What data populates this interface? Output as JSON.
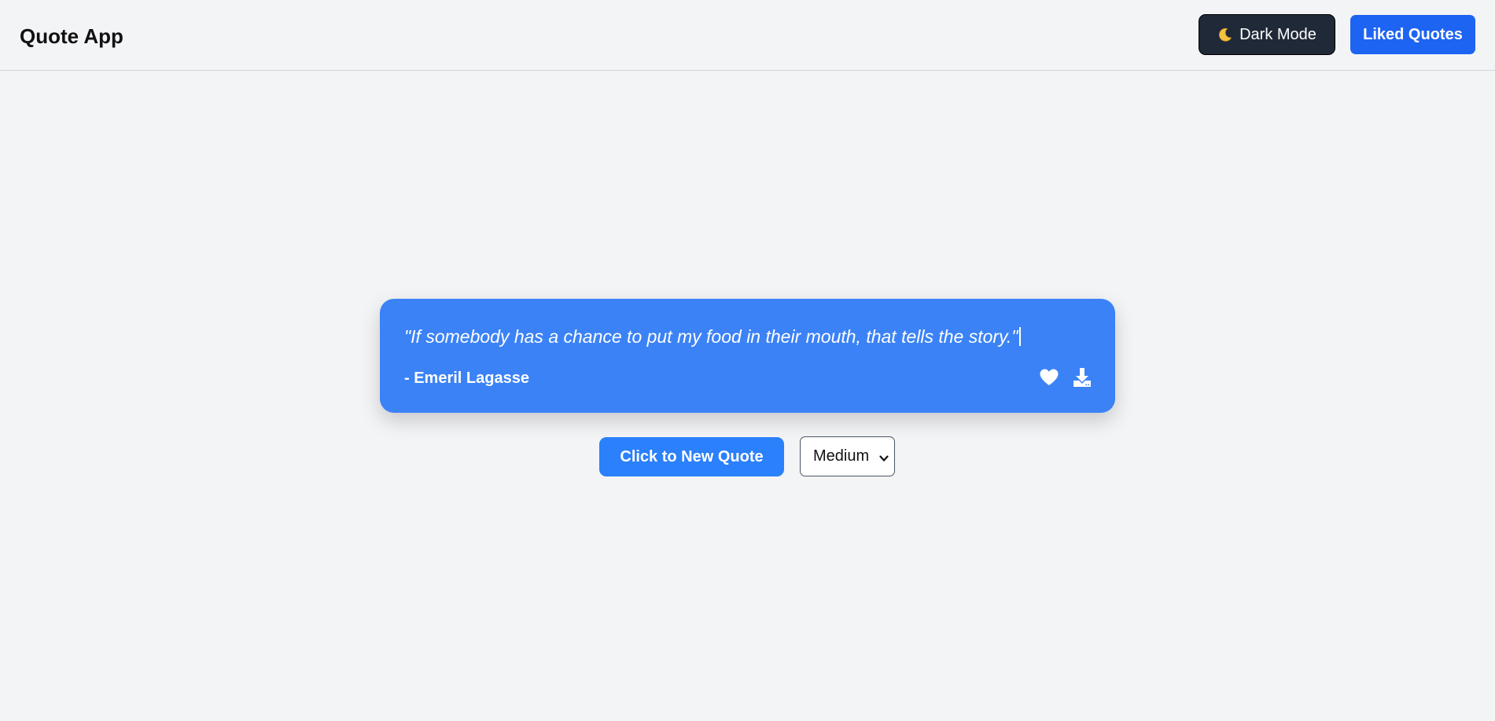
{
  "app": {
    "title": "Quote App"
  },
  "header": {
    "dark_mode_label": "Dark Mode",
    "dark_mode_icon": "moon-icon",
    "liked_quotes_label": "Liked Quotes"
  },
  "quote": {
    "text": "\"If somebody has a chance to put my food in their mouth, that tells the story.\"",
    "author": "- Emeril Lagasse",
    "like_icon": "heart-icon",
    "download_icon": "download-icon"
  },
  "controls": {
    "new_quote_label": "Click to New Quote",
    "size_selected": "Medium"
  },
  "colors": {
    "background": "#f3f4f6",
    "card": "#3b82f6",
    "primary_button": "#2b80fb",
    "liked_button": "#1d64f2",
    "dark_button": "#1f2937"
  }
}
